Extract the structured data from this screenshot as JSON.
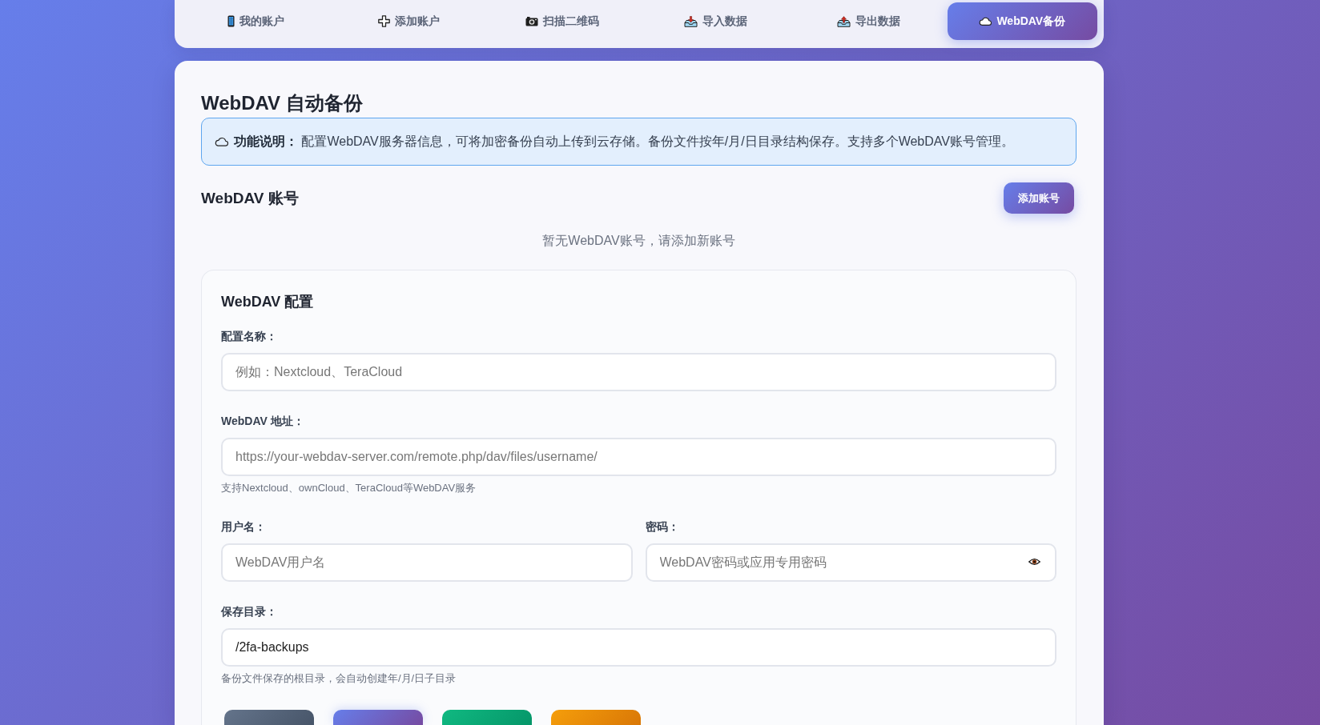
{
  "nav": {
    "tabs": [
      {
        "label": "我的账户",
        "selected": false
      },
      {
        "label": "添加账户",
        "selected": false
      },
      {
        "label": "扫描二维码",
        "selected": false
      },
      {
        "label": "导入数据",
        "selected": false
      },
      {
        "label": "导出数据",
        "selected": false
      },
      {
        "label": "WebDAV备份",
        "selected": true
      }
    ]
  },
  "page": {
    "title": "WebDAV 自动备份",
    "info": "**功能说明：** 配置WebDAV服务器信息，可将加密备份自动上传到云存储。备份文件按年/月/日目录结构保存。支持多个WebDAV账号管理。"
  },
  "accounts": {
    "title": "WebDAV 账号",
    "add_button": "添加账号",
    "empty_text": "暂无WebDAV账号，请添加新账号"
  },
  "config": {
    "title": "WebDAV 配置",
    "rows": [
      {
        "fields": [
          {
            "kind": "text",
            "label": "配置名称：",
            "placeholder": "例如：Nextcloud、TeraCloud"
          }
        ]
      },
      {
        "fields": [
          {
            "kind": "text",
            "label": "WebDAV 地址：",
            "placeholder": "https://your-webdav-server.com/remote.php/dav/files/username/",
            "hint": "支持Nextcloud、ownCloud、TeraCloud等WebDAV服务"
          }
        ]
      },
      {
        "fields": [
          {
            "kind": "text",
            "label": "用户名：",
            "placeholder": "WebDAV用户名"
          },
          {
            "kind": "password",
            "label": "密码：",
            "placeholder": "WebDAV密码或应用专用密码"
          }
        ]
      },
      {
        "fields": [
          {
            "kind": "text",
            "label": "保存目录：",
            "value": "/2fa-backups",
            "hint": "备份文件保存的根目录，会自动创建年/月/日子目录"
          }
        ]
      }
    ],
    "action_buttons": [
      {
        "kind": "secondary"
      },
      {
        "kind": "primary"
      },
      {
        "kind": "success"
      },
      {
        "kind": "warning"
      }
    ]
  }
}
